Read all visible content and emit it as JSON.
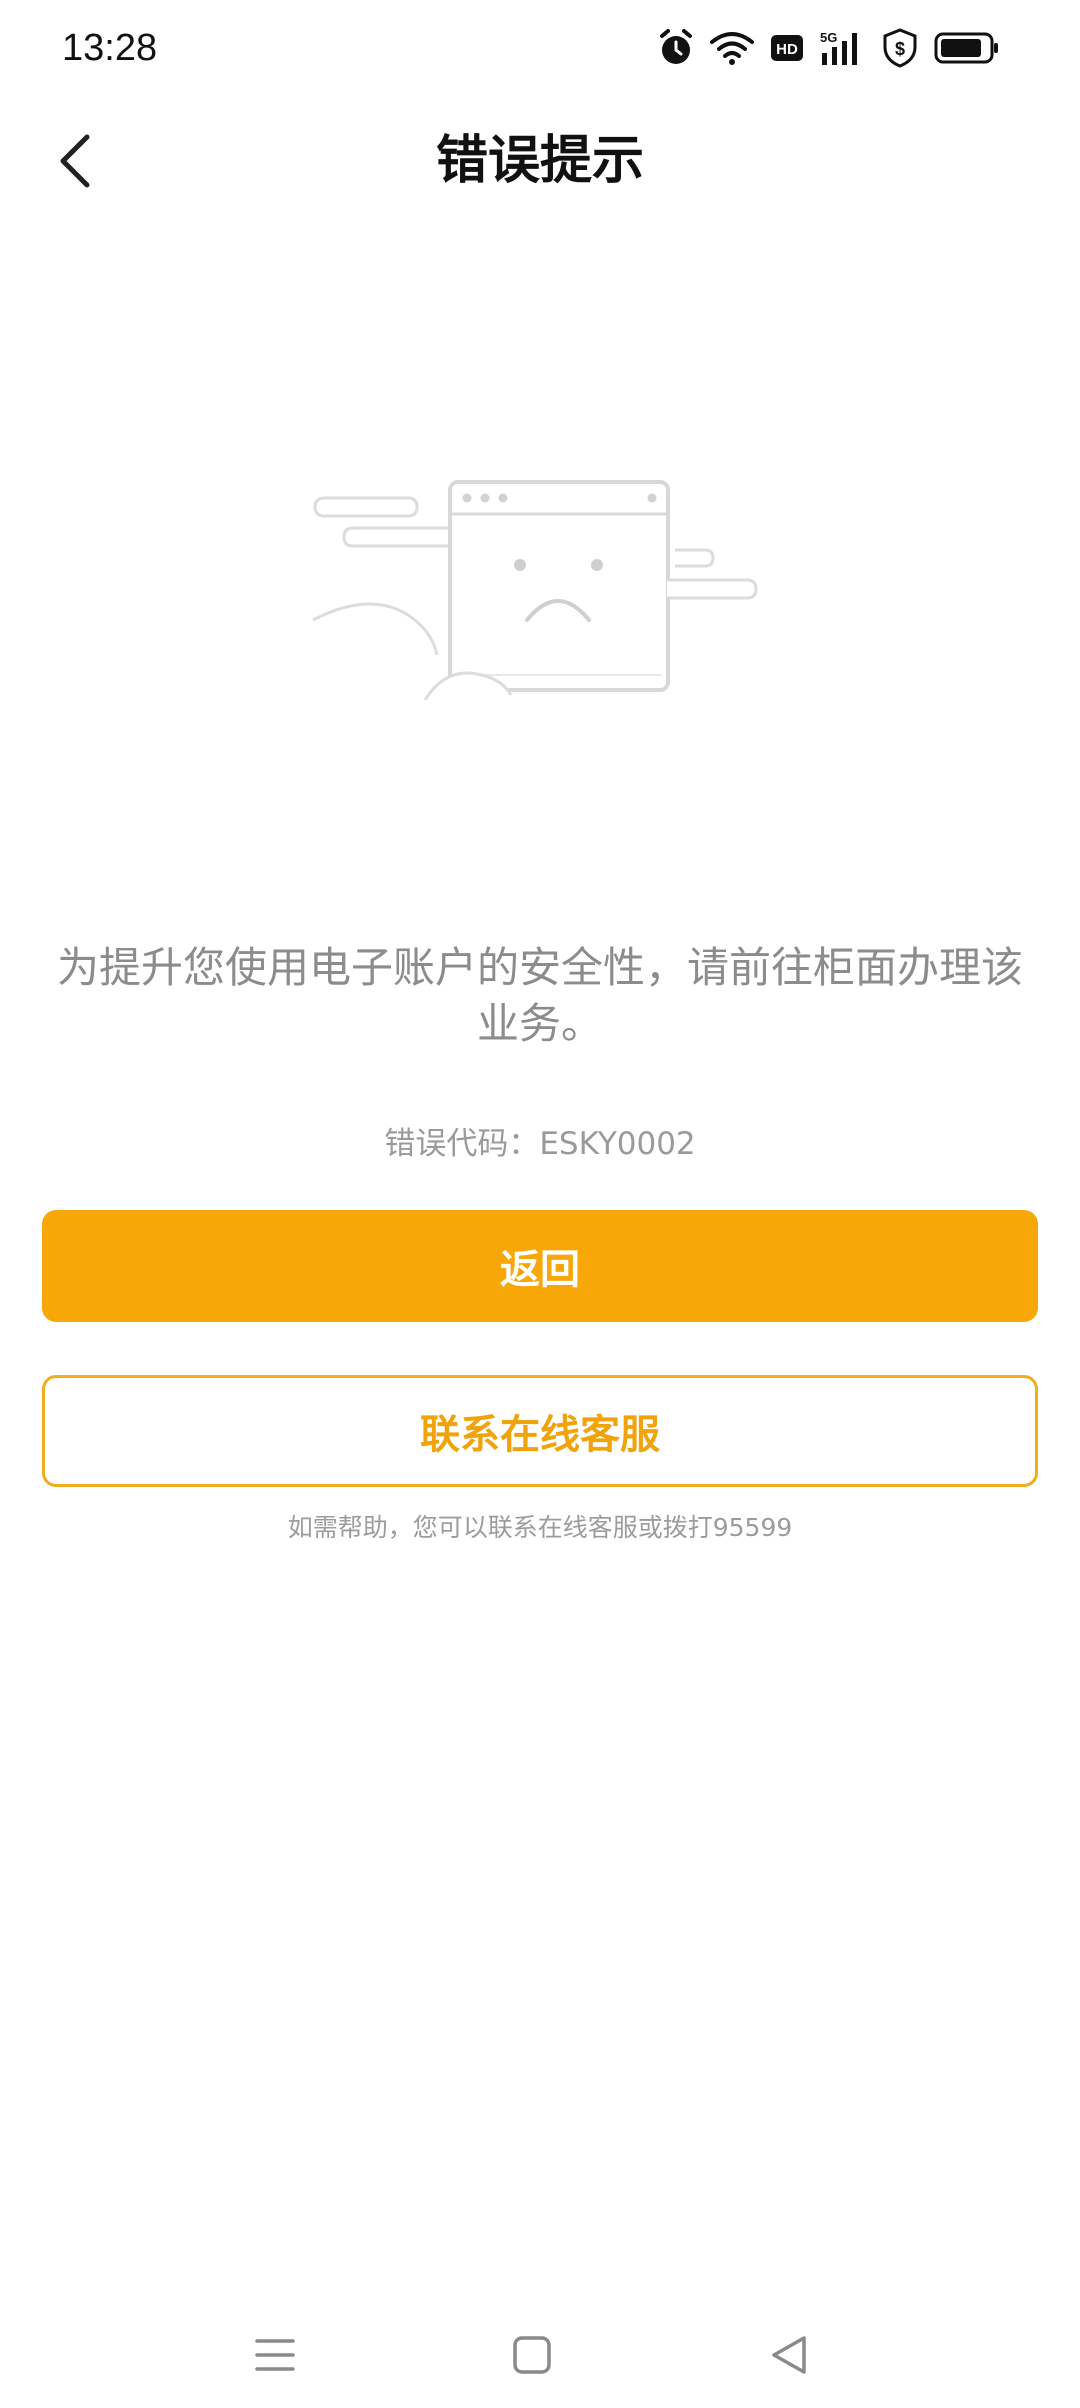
{
  "status_bar": {
    "time": "13:28",
    "icons": [
      "alarm-icon",
      "wifi-icon",
      "hd-icon",
      "5g-signal-icon",
      "shield-dollar-icon",
      "battery-icon"
    ],
    "hd_label": "HD",
    "network_label": "5G"
  },
  "nav": {
    "title": "错误提示",
    "back_icon": "chevron-left-icon"
  },
  "illustration": {
    "icon": "sad-browser-window-icon"
  },
  "message": "为提升您使用电子账户的安全性，请前往柜面办理该业务。",
  "error_code": {
    "label": "错误代码：",
    "value": "ESKY0002"
  },
  "buttons": {
    "back_label": "返回",
    "contact_label": "联系在线客服"
  },
  "help_text": "如需帮助，您可以联系在线客服或拨打95599",
  "colors": {
    "accent": "#f7a808",
    "text_muted": "#8c8c8c"
  },
  "system_nav": {
    "icons": [
      "menu-icon",
      "home-icon",
      "back-triangle-icon"
    ]
  }
}
